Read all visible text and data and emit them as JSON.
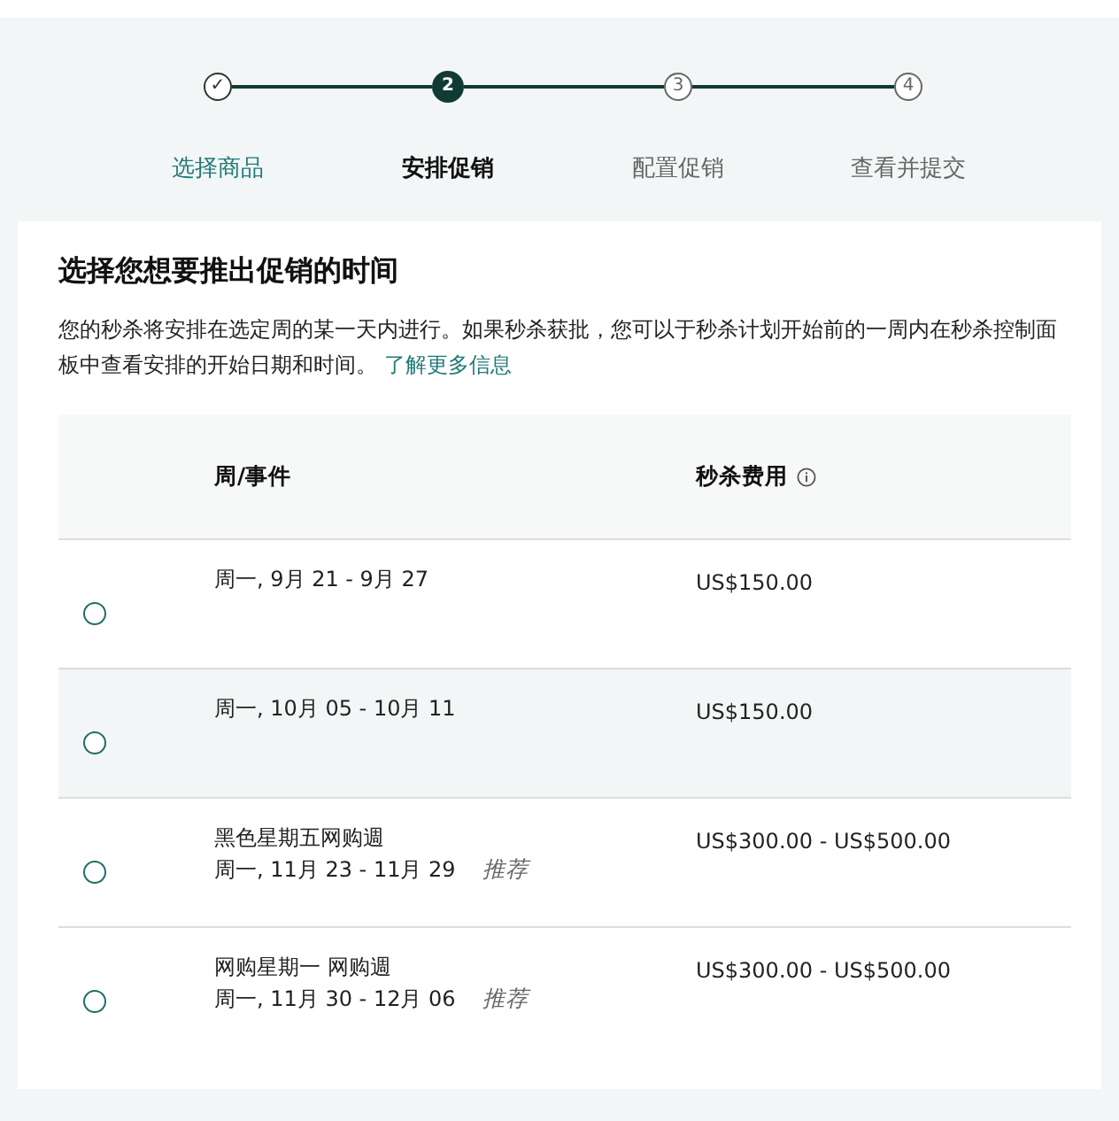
{
  "steps": [
    {
      "label": "选择商品",
      "number": "✓",
      "completed": true,
      "selected": false
    },
    {
      "label": "安排促销",
      "number": "2",
      "completed": false,
      "selected": true
    },
    {
      "label": "配置促销",
      "number": "3",
      "completed": false,
      "selected": false
    },
    {
      "label": "查看并提交",
      "number": "4",
      "completed": false,
      "selected": false
    }
  ],
  "title": "选择您想要推出促销的时间",
  "description": "您的秒杀将安排在选定周的某一天内进行。如果秒杀获批，您可以于秒杀计划开始前的一周内在秒杀控制面板中查看安排的开始日期和时间。",
  "learn_more_link": "了解更多信息",
  "table": {
    "columns": [
      "周/事件",
      "秒杀费用"
    ],
    "rows": [
      {
        "week": "周一, 9月 21 - 9月 27",
        "fee": "US$150.00",
        "selected": false,
        "highlighted": false
      },
      {
        "week": "周一, 10月 05 - 10月 11",
        "fee": "US$150.00",
        "selected": false,
        "highlighted": true
      },
      {
        "event": "黑色星期五网购週",
        "week": "周一, 11月 23 - 11月 29",
        "badge": "推荐",
        "fee": "US$300.00 - US$500.00",
        "selected": false,
        "highlighted": false
      },
      {
        "event": "网购星期一 网购週",
        "week": "周一, 11月 30 - 12月 06",
        "badge": "推荐",
        "fee": "US$300.00 - US$500.00",
        "selected": false,
        "highlighted": false
      }
    ]
  }
}
